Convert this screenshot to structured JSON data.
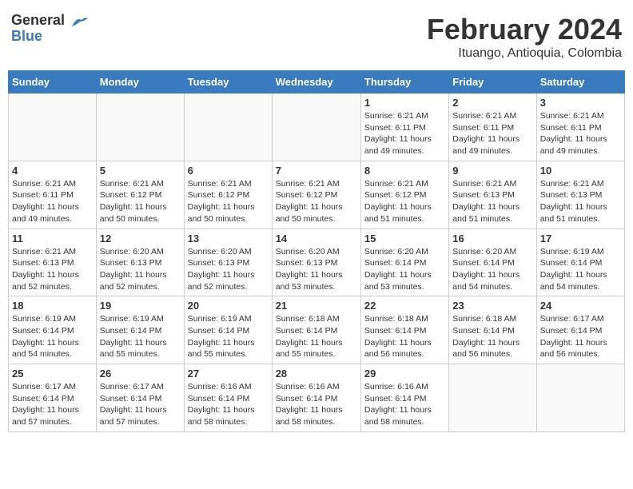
{
  "header": {
    "logo_general": "General",
    "logo_blue": "Blue",
    "month_title": "February 2024",
    "location": "Ituango, Antioquia, Colombia"
  },
  "days_of_week": [
    "Sunday",
    "Monday",
    "Tuesday",
    "Wednesday",
    "Thursday",
    "Friday",
    "Saturday"
  ],
  "weeks": [
    [
      {
        "day": "",
        "info": ""
      },
      {
        "day": "",
        "info": ""
      },
      {
        "day": "",
        "info": ""
      },
      {
        "day": "",
        "info": ""
      },
      {
        "day": "1",
        "info": "Sunrise: 6:21 AM\nSunset: 6:11 PM\nDaylight: 11 hours\nand 49 minutes."
      },
      {
        "day": "2",
        "info": "Sunrise: 6:21 AM\nSunset: 6:11 PM\nDaylight: 11 hours\nand 49 minutes."
      },
      {
        "day": "3",
        "info": "Sunrise: 6:21 AM\nSunset: 6:11 PM\nDaylight: 11 hours\nand 49 minutes."
      }
    ],
    [
      {
        "day": "4",
        "info": "Sunrise: 6:21 AM\nSunset: 6:11 PM\nDaylight: 11 hours\nand 49 minutes."
      },
      {
        "day": "5",
        "info": "Sunrise: 6:21 AM\nSunset: 6:12 PM\nDaylight: 11 hours\nand 50 minutes."
      },
      {
        "day": "6",
        "info": "Sunrise: 6:21 AM\nSunset: 6:12 PM\nDaylight: 11 hours\nand 50 minutes."
      },
      {
        "day": "7",
        "info": "Sunrise: 6:21 AM\nSunset: 6:12 PM\nDaylight: 11 hours\nand 50 minutes."
      },
      {
        "day": "8",
        "info": "Sunrise: 6:21 AM\nSunset: 6:12 PM\nDaylight: 11 hours\nand 51 minutes."
      },
      {
        "day": "9",
        "info": "Sunrise: 6:21 AM\nSunset: 6:13 PM\nDaylight: 11 hours\nand 51 minutes."
      },
      {
        "day": "10",
        "info": "Sunrise: 6:21 AM\nSunset: 6:13 PM\nDaylight: 11 hours\nand 51 minutes."
      }
    ],
    [
      {
        "day": "11",
        "info": "Sunrise: 6:21 AM\nSunset: 6:13 PM\nDaylight: 11 hours\nand 52 minutes."
      },
      {
        "day": "12",
        "info": "Sunrise: 6:20 AM\nSunset: 6:13 PM\nDaylight: 11 hours\nand 52 minutes."
      },
      {
        "day": "13",
        "info": "Sunrise: 6:20 AM\nSunset: 6:13 PM\nDaylight: 11 hours\nand 52 minutes."
      },
      {
        "day": "14",
        "info": "Sunrise: 6:20 AM\nSunset: 6:13 PM\nDaylight: 11 hours\nand 53 minutes."
      },
      {
        "day": "15",
        "info": "Sunrise: 6:20 AM\nSunset: 6:14 PM\nDaylight: 11 hours\nand 53 minutes."
      },
      {
        "day": "16",
        "info": "Sunrise: 6:20 AM\nSunset: 6:14 PM\nDaylight: 11 hours\nand 54 minutes."
      },
      {
        "day": "17",
        "info": "Sunrise: 6:19 AM\nSunset: 6:14 PM\nDaylight: 11 hours\nand 54 minutes."
      }
    ],
    [
      {
        "day": "18",
        "info": "Sunrise: 6:19 AM\nSunset: 6:14 PM\nDaylight: 11 hours\nand 54 minutes."
      },
      {
        "day": "19",
        "info": "Sunrise: 6:19 AM\nSunset: 6:14 PM\nDaylight: 11 hours\nand 55 minutes."
      },
      {
        "day": "20",
        "info": "Sunrise: 6:19 AM\nSunset: 6:14 PM\nDaylight: 11 hours\nand 55 minutes."
      },
      {
        "day": "21",
        "info": "Sunrise: 6:18 AM\nSunset: 6:14 PM\nDaylight: 11 hours\nand 55 minutes."
      },
      {
        "day": "22",
        "info": "Sunrise: 6:18 AM\nSunset: 6:14 PM\nDaylight: 11 hours\nand 56 minutes."
      },
      {
        "day": "23",
        "info": "Sunrise: 6:18 AM\nSunset: 6:14 PM\nDaylight: 11 hours\nand 56 minutes."
      },
      {
        "day": "24",
        "info": "Sunrise: 6:17 AM\nSunset: 6:14 PM\nDaylight: 11 hours\nand 56 minutes."
      }
    ],
    [
      {
        "day": "25",
        "info": "Sunrise: 6:17 AM\nSunset: 6:14 PM\nDaylight: 11 hours\nand 57 minutes."
      },
      {
        "day": "26",
        "info": "Sunrise: 6:17 AM\nSunset: 6:14 PM\nDaylight: 11 hours\nand 57 minutes."
      },
      {
        "day": "27",
        "info": "Sunrise: 6:16 AM\nSunset: 6:14 PM\nDaylight: 11 hours\nand 58 minutes."
      },
      {
        "day": "28",
        "info": "Sunrise: 6:16 AM\nSunset: 6:14 PM\nDaylight: 11 hours\nand 58 minutes."
      },
      {
        "day": "29",
        "info": "Sunrise: 6:16 AM\nSunset: 6:14 PM\nDaylight: 11 hours\nand 58 minutes."
      },
      {
        "day": "",
        "info": ""
      },
      {
        "day": "",
        "info": ""
      }
    ]
  ]
}
